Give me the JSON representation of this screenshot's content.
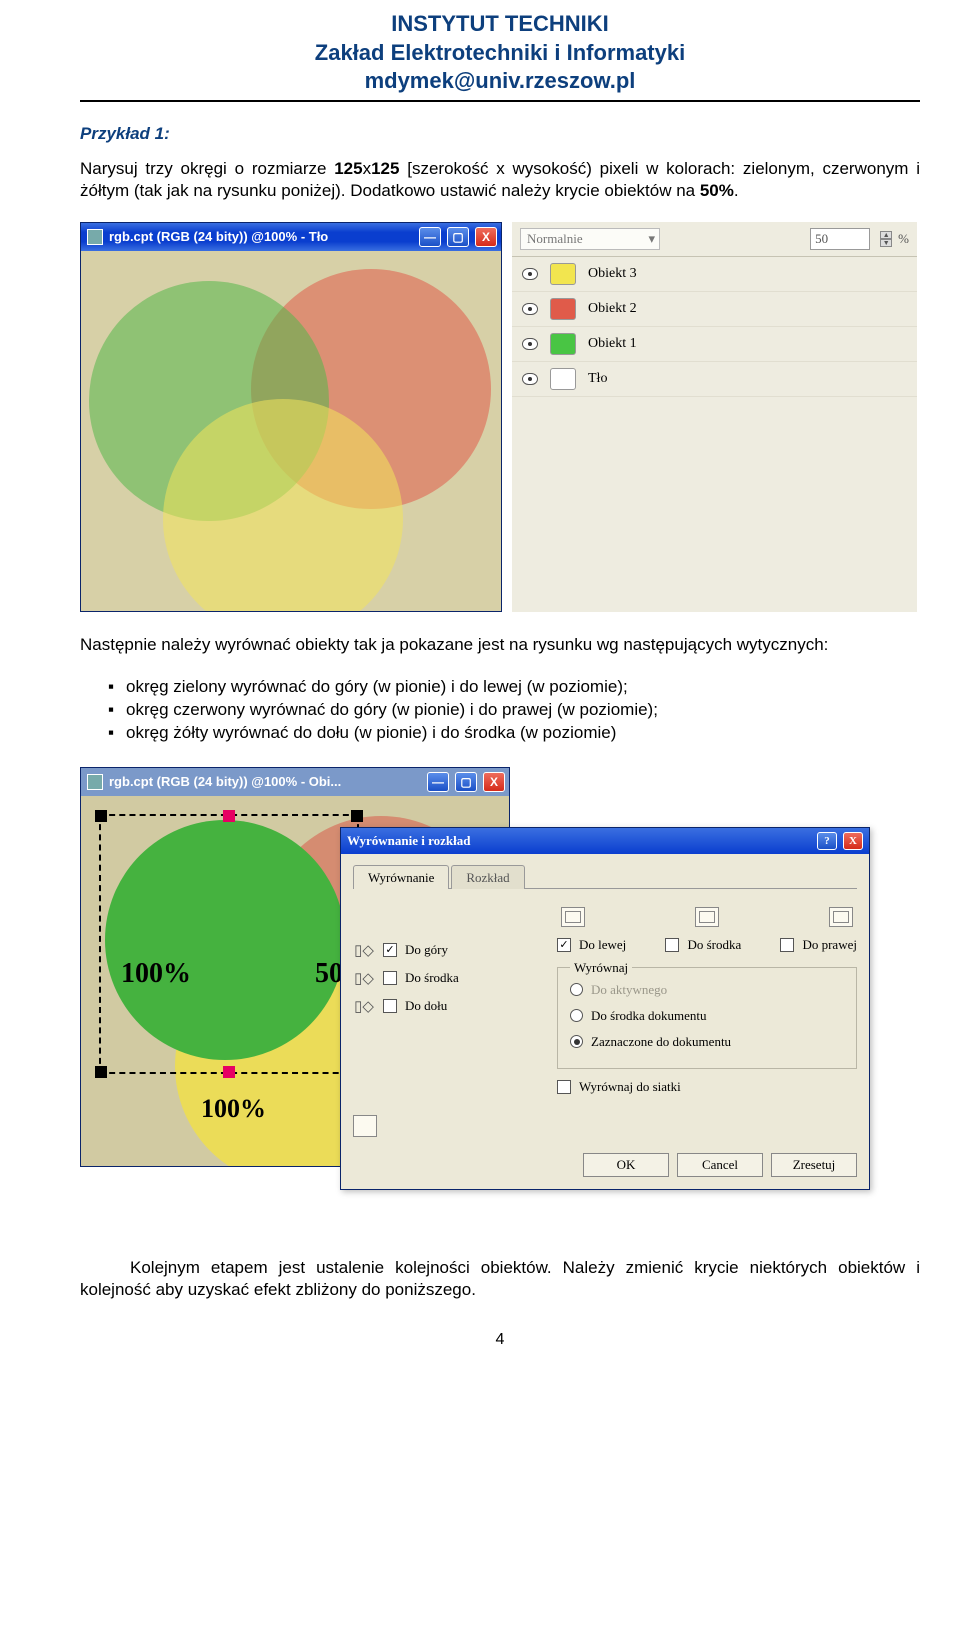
{
  "header": {
    "line1": "INSTYTUT TECHNIKI",
    "line2": "Zakład Elektrotechniki i Informatyki",
    "line3": "mdymek@univ.rzeszow.pl"
  },
  "example_heading": "Przykład 1:",
  "para1_prefix": "Narysuj trzy okręgi o rozmiarze ",
  "para1_size": "125",
  "para1_x": "x",
  "para1_mid1": " [szerokość x wysokość) pixeli w kolorach: zielonym, czerwonym i żółtym (tak jak na rysunku poniżej). Dodatkowo ustawić należy krycie obiektów na ",
  "para1_pct": "50%",
  "para1_end": ".",
  "fig1": {
    "window_title": "rgb.cpt (RGB (24 bity)) @100% - Tło",
    "btn_min": "—",
    "btn_max": "▢",
    "btn_close": "X",
    "combo_mode": "Normalnie",
    "combo_arrow": "▾",
    "opacity_value": "50",
    "opacity_unit": "%",
    "layer1": "Obiekt 3",
    "layer2": "Obiekt 2",
    "layer3": "Obiekt 1",
    "layer4": "Tło"
  },
  "para2": "Następnie należy wyrównać obiekty tak ja pokazane jest na rysunku wg następujących wytycznych:",
  "bullets": {
    "b1": "okręg zielony wyrównać do góry (w pionie) i do lewej (w poziomie);",
    "b2": "okręg czerwony wyrównać do góry (w pionie) i do prawej (w poziomie);",
    "b3": "okręg żółty wyrównać do dołu (w pionie) i do środka (w poziomie)"
  },
  "fig2": {
    "window_title": "rgb.cpt (RGB (24 bity)) @100% - Obi...",
    "btn_min": "—",
    "btn_max": "▢",
    "btn_close": "X",
    "pct_a": "100%",
    "pct_b": "50",
    "pct_c": "100%",
    "dialog": {
      "title": "Wyrównanie i rozkład",
      "q": "?",
      "x": "X",
      "tab1": "Wyrównanie",
      "tab2": "Rozkład",
      "do_lewej": "Do lewej",
      "do_srodka": "Do środka",
      "do_prawej": "Do prawej",
      "do_gory": "Do góry",
      "do_srodka_v": "Do środka",
      "do_dolu": "Do dołu",
      "group_label": "Wyrównaj",
      "do_aktywnego": "Do aktywnego",
      "do_srodka_dokumentu": "Do środka dokumentu",
      "zaznaczone_do_dokumentu": "Zaznaczone do dokumentu",
      "wyrd_siatki": "Wyrównaj do siatki",
      "ok": "OK",
      "cancel": "Cancel",
      "reset": "Zresetuj"
    }
  },
  "para3": "Kolejnym etapem jest ustalenie kolejności obiektów. Należy zmienić krycie niektórych obiektów i kolejność aby uzyskać efekt zbliżony do poniższego.",
  "page_number": "4"
}
